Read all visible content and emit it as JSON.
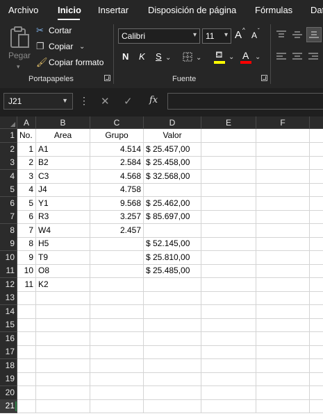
{
  "tabs": [
    "Archivo",
    "Inicio",
    "Insertar",
    "Disposición de página",
    "Fórmulas",
    "Dat"
  ],
  "clipboard": {
    "paste_label": "Pegar",
    "cut_label": "Cortar",
    "copy_label": "Copiar",
    "format_painter_label": "Copiar formato",
    "group_label": "Portapapeles"
  },
  "font": {
    "family": "Calibri",
    "size": "11",
    "bold": "N",
    "italic": "K",
    "underline": "S",
    "color_glyph": "A",
    "grow_glyph": "A",
    "shrink_glyph": "A",
    "group_label": "Fuente",
    "highlight_color": "#ffff00",
    "font_color": "#ff0000"
  },
  "formula_bar": {
    "name_box": "J21",
    "fx": "fx",
    "formula": ""
  },
  "columns": [
    "A",
    "B",
    "C",
    "D",
    "E",
    "F"
  ],
  "rows": [
    {
      "n": "1",
      "a": "No.",
      "b": "Area",
      "c": "Grupo",
      "d": "Valor"
    },
    {
      "n": "2",
      "a": "1",
      "b": "A1",
      "c": "4.514",
      "d": "$ 25.457,00"
    },
    {
      "n": "3",
      "a": "2",
      "b": "B2",
      "c": "2.584",
      "d": "$ 25.458,00"
    },
    {
      "n": "4",
      "a": "3",
      "b": "C3",
      "c": "4.568",
      "d": "$ 32.568,00"
    },
    {
      "n": "5",
      "a": "4",
      "b": "J4",
      "c": "4.758",
      "d": ""
    },
    {
      "n": "6",
      "a": "5",
      "b": "Y1",
      "c": "9.568",
      "d": "$ 25.462,00"
    },
    {
      "n": "7",
      "a": "6",
      "b": "R3",
      "c": "3.257",
      "d": "$ 85.697,00"
    },
    {
      "n": "8",
      "a": "7",
      "b": "W4",
      "c": "2.457",
      "d": ""
    },
    {
      "n": "9",
      "a": "8",
      "b": "H5",
      "c": "",
      "d": "$ 52.145,00"
    },
    {
      "n": "10",
      "a": "9",
      "b": "T9",
      "c": "",
      "d": "$ 25.810,00"
    },
    {
      "n": "11",
      "a": "10",
      "b": "O8",
      "c": "",
      "d": "$ 25.485,00"
    },
    {
      "n": "12",
      "a": "11",
      "b": "K2",
      "c": "",
      "d": ""
    },
    {
      "n": "13",
      "a": "",
      "b": "",
      "c": "",
      "d": ""
    },
    {
      "n": "14",
      "a": "",
      "b": "",
      "c": "",
      "d": ""
    },
    {
      "n": "15",
      "a": "",
      "b": "",
      "c": "",
      "d": ""
    },
    {
      "n": "16",
      "a": "",
      "b": "",
      "c": "",
      "d": ""
    },
    {
      "n": "17",
      "a": "",
      "b": "",
      "c": "",
      "d": ""
    },
    {
      "n": "18",
      "a": "",
      "b": "",
      "c": "",
      "d": ""
    },
    {
      "n": "19",
      "a": "",
      "b": "",
      "c": "",
      "d": ""
    },
    {
      "n": "20",
      "a": "",
      "b": "",
      "c": "",
      "d": ""
    },
    {
      "n": "21",
      "a": "",
      "b": "",
      "c": "",
      "d": ""
    }
  ],
  "selected_row": "21"
}
